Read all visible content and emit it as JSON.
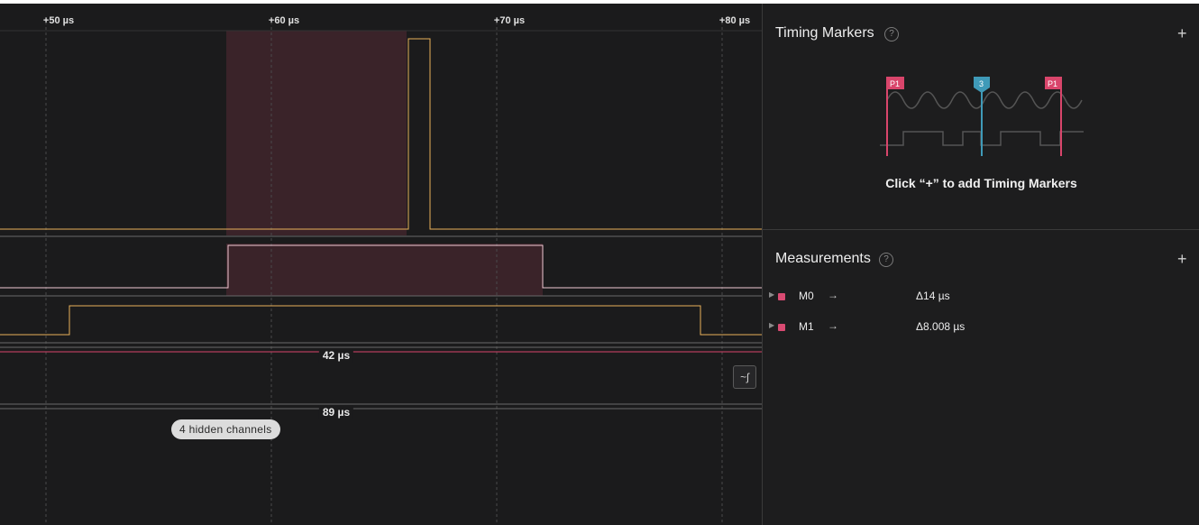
{
  "timeline": {
    "ticks": [
      "+50 µs",
      "+60 µs",
      "+70 µs",
      "+80 µs"
    ],
    "bus_labels": [
      "42 µs",
      "89 µs"
    ],
    "hidden_channels_label": "4 hidden channels",
    "edge_button_glyph": "~ʃ"
  },
  "panel": {
    "timing_markers": {
      "title": "Timing Markers",
      "help_glyph": "?",
      "add_glyph": "+",
      "art_flags": [
        "P1",
        "3",
        "P1"
      ],
      "hint": "Click “+” to add Timing Markers"
    },
    "measurements": {
      "title": "Measurements",
      "help_glyph": "?",
      "add_glyph": "+",
      "arrow_glyph": "→",
      "items": [
        {
          "name": "M0",
          "value": "Δ14 µs"
        },
        {
          "name": "M1",
          "value": "Δ8.008 µs"
        }
      ]
    }
  },
  "colors": {
    "background": "#1b1b1c",
    "signal_orange": "#e8b25a",
    "signal_pink": "#f0c8d4",
    "highlight": "#3a2329",
    "marker_pink": "#d9456b",
    "marker_blue": "#3f9ab8"
  }
}
